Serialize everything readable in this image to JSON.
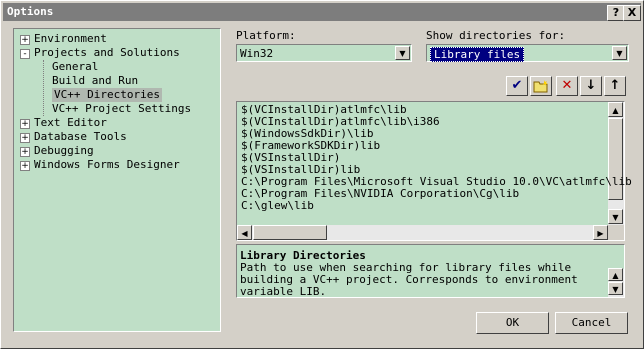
{
  "window": {
    "title": "Options",
    "help_label": "?",
    "close_label": "X"
  },
  "tree": {
    "items": [
      {
        "label": "Environment",
        "level": 0,
        "expander": "+"
      },
      {
        "label": "Projects and Solutions",
        "level": 0,
        "expander": "-"
      },
      {
        "label": "General",
        "level": 1
      },
      {
        "label": "Build and Run",
        "level": 1
      },
      {
        "label": "VC++ Directories",
        "level": 1,
        "selected": true
      },
      {
        "label": "VC++ Project Settings",
        "level": 1
      },
      {
        "label": "Text Editor",
        "level": 0,
        "expander": "+"
      },
      {
        "label": "Database Tools",
        "level": 0,
        "expander": "+"
      },
      {
        "label": "Debugging",
        "level": 0,
        "expander": "+"
      },
      {
        "label": "Windows Forms Designer",
        "level": 0,
        "expander": "+"
      }
    ]
  },
  "platform": {
    "label": "Platform:",
    "value": "Win32"
  },
  "show_dirs": {
    "label": "Show directories for:",
    "value": "Library files"
  },
  "toolbar": {
    "icons": [
      "checkmark-icon",
      "new-folder-icon",
      "delete-icon",
      "move-down-icon",
      "move-up-icon"
    ],
    "glyphs": [
      "✔",
      "📁",
      "✕",
      "↓",
      "↑"
    ]
  },
  "directories": {
    "rows": [
      "$(VCInstallDir)atlmfc\\lib",
      "$(VCInstallDir)atlmfc\\lib\\i386",
      "$(WindowsSdkDir)\\lib",
      "$(FrameworkSDKDir)lib",
      "$(VSInstallDir)",
      "$(VSInstallDir)lib",
      "C:\\Program Files\\Microsoft Visual Studio 10.0\\VC\\atlmfc\\lib",
      "C:\\Program Files\\NVIDIA Corporation\\Cg\\lib",
      "C:\\glew\\lib"
    ]
  },
  "description": {
    "title": "Library Directories",
    "text": "Path to use when searching for library files while building a VC++ project.  Corresponds to environment variable LIB."
  },
  "buttons": {
    "ok": "OK",
    "cancel": "Cancel"
  },
  "colors": {
    "panel_bg": "#bfdfc7",
    "highlight": "#000080"
  }
}
